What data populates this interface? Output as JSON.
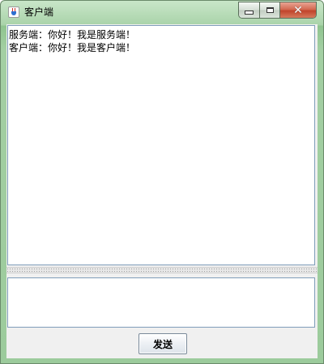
{
  "window": {
    "title": "客户端",
    "controls": {
      "minimize_icon": "minimize-icon",
      "maximize_icon": "maximize-icon",
      "close_icon": "close-icon"
    },
    "app_icon": "java-cup-icon"
  },
  "chat": {
    "messages": [
      "服务端：你好！我是服务端！",
      "客户端：你好！我是客户端！"
    ]
  },
  "input": {
    "value": ""
  },
  "actions": {
    "send_label": "发送"
  },
  "colors": {
    "frame": "#9ccb9c",
    "close_button": "#c0442b",
    "text_border": "#7f9db9"
  }
}
